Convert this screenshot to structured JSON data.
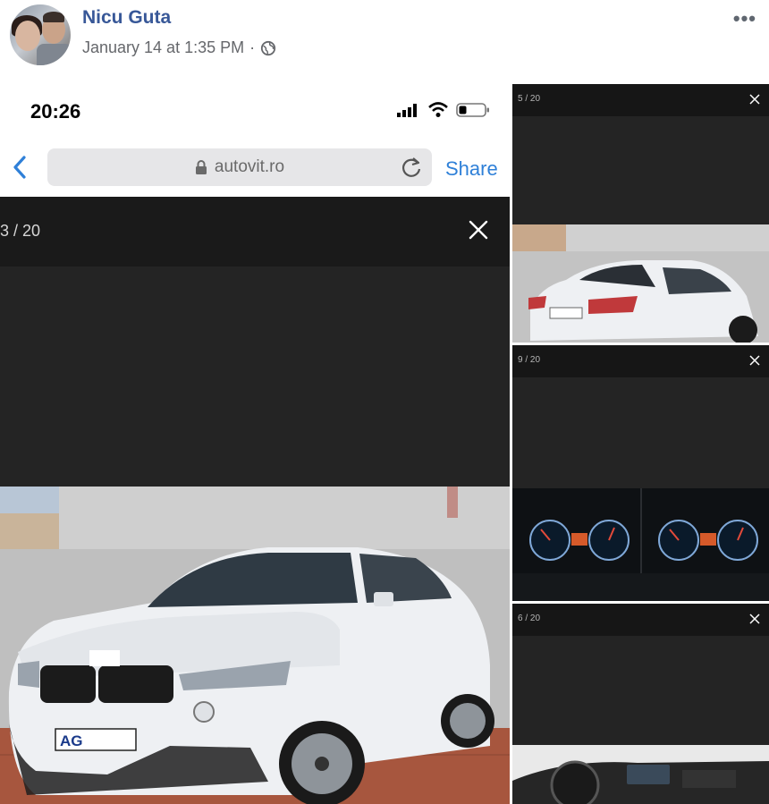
{
  "post": {
    "author": "Nicu Guta",
    "timestamp": "January 14 at 1:35 PM",
    "separator": "·",
    "privacy_icon": "globe-icon",
    "more_icon": "more-options-icon",
    "more_label": "•••"
  },
  "phone": {
    "time": "20:26",
    "url": "autovit.ro",
    "share_label": "Share",
    "gallery_counter": "3 / 20"
  },
  "thumbnails": [
    {
      "counter": "5 / 20",
      "subject": "white SUV rear view"
    },
    {
      "counter": "9 / 20",
      "subject": "instrument cluster"
    },
    {
      "counter": "6 / 20",
      "subject": "interior dashboard"
    }
  ],
  "main_photo": {
    "plate_text": "AG",
    "subject": "white BMW X6 front view"
  },
  "colors": {
    "link_blue": "#385898",
    "ios_blue": "#2f80d8",
    "gallery_dark": "#242424",
    "car_white": "#f1f2f4"
  }
}
